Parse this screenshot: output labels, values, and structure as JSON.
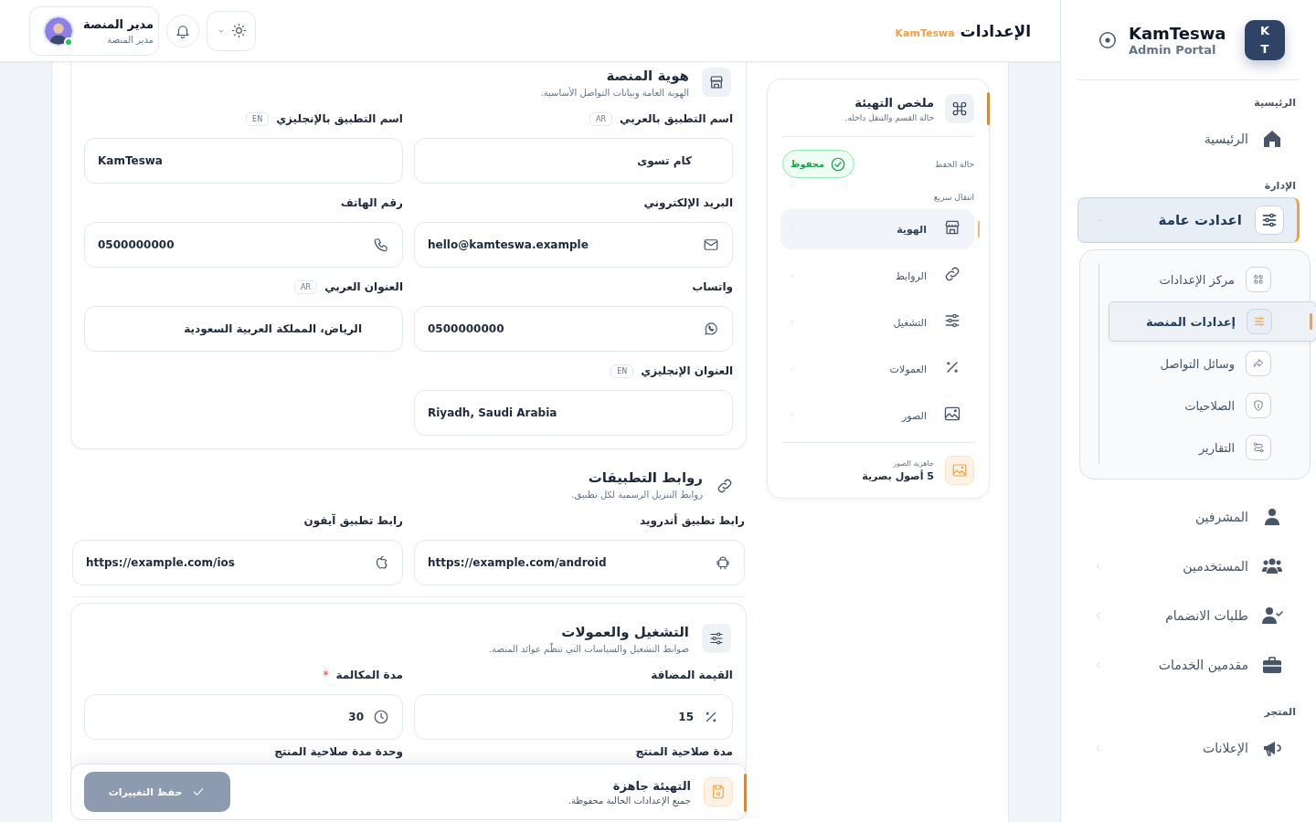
{
  "topbar": {
    "brand": "KamTeswa",
    "title": "الإعدادات",
    "user": {
      "name": "مدير المنصة",
      "role": "مدير المنصة",
      "online": true
    }
  },
  "sidebar": {
    "logo_lines": [
      "K",
      "T"
    ],
    "brand": "KamTeswa",
    "subtitle": "Admin Portal",
    "sections": [
      {
        "title": "الرئيسية",
        "items": [
          {
            "label": "الرئيسية",
            "kind": "home",
            "selected": false
          }
        ]
      },
      {
        "title": "الإدارة",
        "items": [
          {
            "label": "اعدادت عامة",
            "kind": "sliders",
            "selected": true,
            "expanded": true,
            "children": [
              {
                "label": "مركز الإعدادات",
                "kind": "grid",
                "selected": false
              },
              {
                "label": "إعدادات المنصة",
                "kind": "sliders",
                "selected": true
              },
              {
                "label": "وسائل التواصل",
                "kind": "share",
                "selected": false
              },
              {
                "label": "الصلاحيات",
                "kind": "shield",
                "selected": false
              },
              {
                "label": "التقارير",
                "kind": "route",
                "selected": false
              }
            ]
          },
          {
            "label": "المشرفين",
            "kind": "admin",
            "selected": false
          },
          {
            "label": "المستخدمين",
            "kind": "users",
            "selected": false,
            "expanded": false
          },
          {
            "label": "طلبات الانضمام",
            "kind": "usercheck",
            "selected": false,
            "expanded": false
          },
          {
            "label": "مقدمين الخدمات",
            "kind": "briefcase",
            "selected": false,
            "expanded": false
          }
        ]
      },
      {
        "title": "المتجر",
        "items": [
          {
            "label": "الإعلانات",
            "kind": "megaphone",
            "selected": false,
            "expanded": false
          }
        ]
      }
    ]
  },
  "summary": {
    "title": "ملخص التهيئة",
    "subtitle": "حالة القسم والتنقل داخله.",
    "save_label": "حالة الحفظ",
    "save_badge": "محفوظ",
    "nav_label": "انتقال سريع",
    "nav": [
      {
        "label": "الهوية",
        "kind": "store",
        "selected": true
      },
      {
        "label": "الروابط",
        "kind": "link",
        "selected": false
      },
      {
        "label": "التشغيل",
        "kind": "sliders",
        "selected": false
      },
      {
        "label": "العمولات",
        "kind": "percent",
        "selected": false
      },
      {
        "label": "الصور",
        "kind": "image",
        "selected": false
      }
    ],
    "footer": {
      "label": "جاهزية الصور",
      "value": "5 أصول بصرية"
    }
  },
  "sections": [
    {
      "kind": "card",
      "title": "هوية المنصة",
      "subtitle": "الهوية العامة وبيانات التواصل الأساسية.",
      "fields": [
        {
          "kind": "text",
          "label": "اسم التطبيق بالعربي",
          "tag": "AR",
          "value": "كام تسوى"
        },
        {
          "kind": "text",
          "label": "اسم التطبيق بالإنجليزي",
          "tag": "EN",
          "value": "KamTeswa"
        },
        {
          "kind": "mail",
          "label": "البريد الإلكتروني",
          "value": "hello@kamteswa.example"
        },
        {
          "kind": "phone",
          "label": "رقم الهاتف",
          "value": "0500000000"
        },
        {
          "kind": "whatsapp",
          "label": "واتساب",
          "value": "0500000000"
        },
        {
          "kind": "text",
          "label": "العنوان العربي",
          "tag": "AR",
          "value": "الرياض، المملكة العربية السعودية"
        },
        {
          "kind": "text",
          "label": "العنوان الإنجليزي",
          "tag": "EN",
          "value": "Riyadh, Saudi Arabia"
        }
      ]
    },
    {
      "kind": "plain",
      "title": "روابط التطبيقات",
      "subtitle": "روابط التنزيل الرسمية لكل تطبيق.",
      "fields": [
        {
          "kind": "android",
          "label": "رابط تطبيق أندرويد",
          "value": "https://example.com/android"
        },
        {
          "kind": "apple",
          "label": "رابط تطبيق آيفون",
          "value": "https://example.com/ios"
        }
      ]
    },
    {
      "kind": "card",
      "title": "التشغيل والعمولات",
      "subtitle": "ضوابط التشغيل والسياسات التي تنظّم عوائد المنصة.",
      "fields": [
        {
          "kind": "percent",
          "label": "القيمة المضافة",
          "value": "15"
        },
        {
          "kind": "clock",
          "label": "مدة المكالمة",
          "required_mark": "*",
          "value": "30"
        },
        {
          "kind": "label",
          "label": "مدة صلاحية المنتج"
        },
        {
          "kind": "label",
          "label": "وحدة مدة صلاحية المنتج"
        }
      ]
    }
  ],
  "save_bar": {
    "title": "التهيئة جاهزة",
    "subtitle": "جميع الإعدادات الحالية محفوظة.",
    "button": "حفظ التغييرات",
    "disabled": true
  }
}
